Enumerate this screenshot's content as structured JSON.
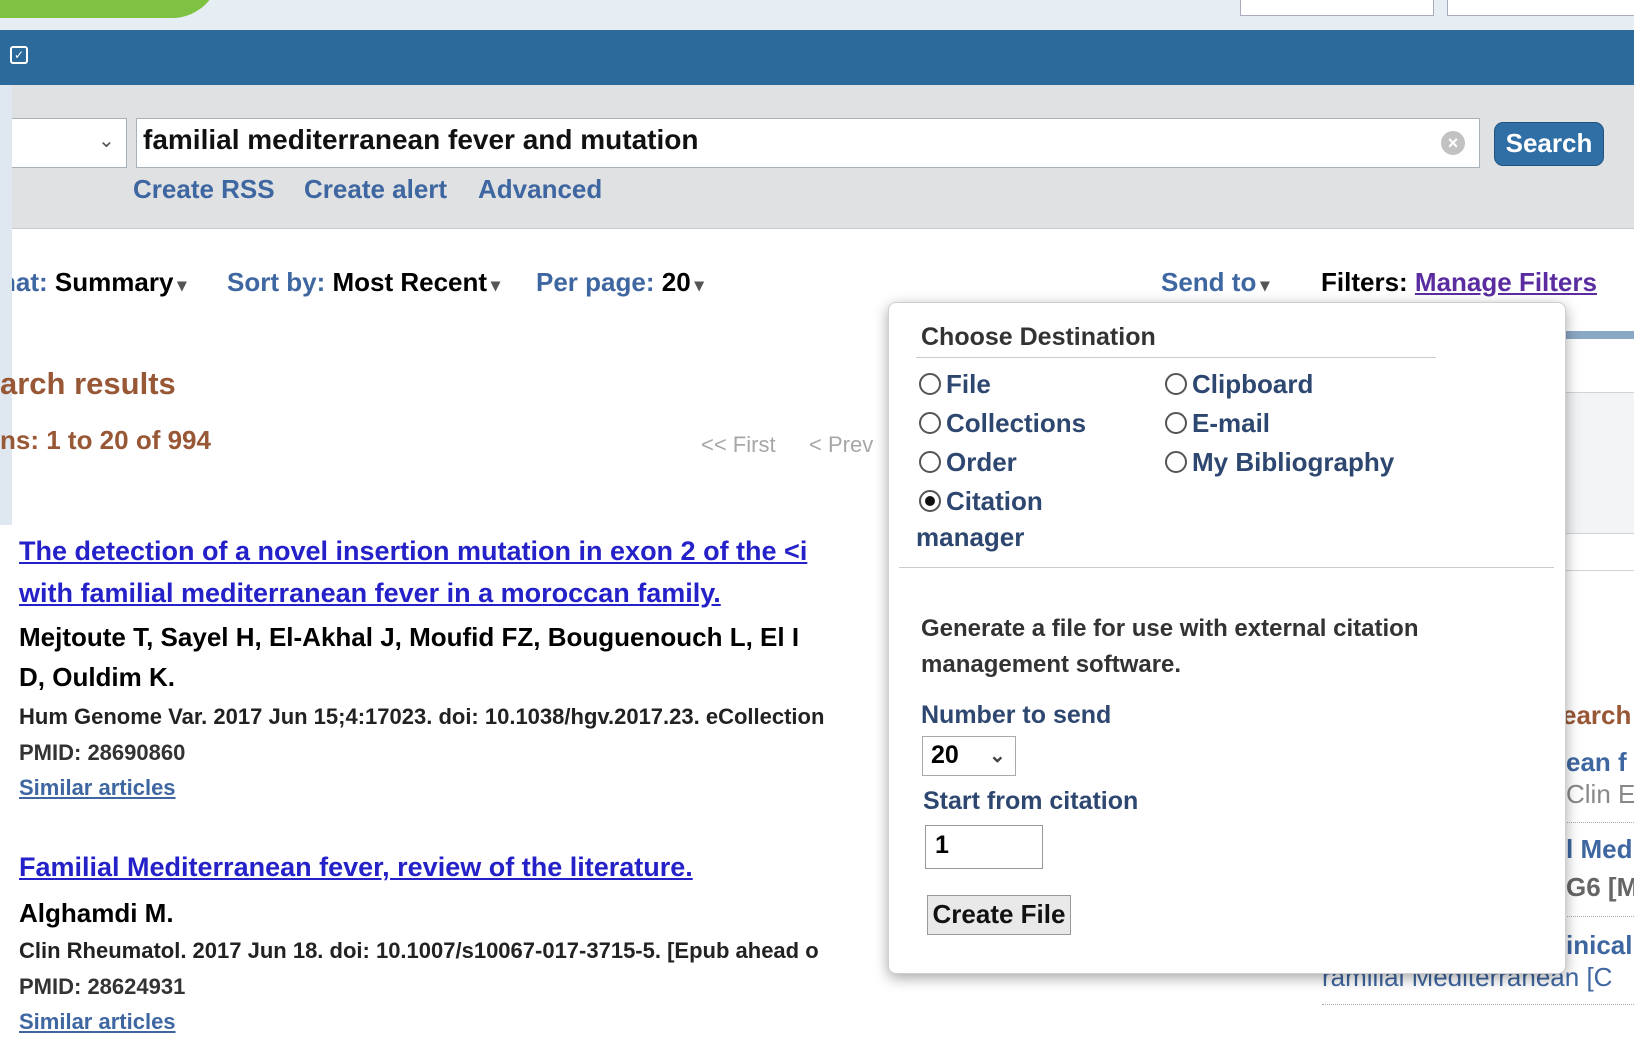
{
  "search": {
    "query": "familial mediterranean fever and mutation",
    "button_label": "Search",
    "links": [
      "Create RSS",
      "Create alert",
      "Advanced"
    ]
  },
  "toolbar": {
    "format_label": "nat:",
    "format_value": "Summary",
    "sort_label": "Sort by:",
    "sort_value": "Most Recent",
    "per_page_label": "Per page:",
    "per_page_value": "20",
    "send_to": "Send to",
    "filters_label": "Filters:",
    "manage_filters": "Manage Filters"
  },
  "results": {
    "title": "arch results",
    "count": "ns: 1 to 20 of 994",
    "pager_first": "<< First",
    "pager_prev": "< Prev"
  },
  "articles": [
    {
      "title_line1": "The detection of a novel insertion mutation in exon 2 of the <i",
      "title_line2": "with familial mediterranean fever in a moroccan family.",
      "authors_line1": "Mejtoute T, Sayel H, El-Akhal J, Moufid FZ, Bouguenouch L, El I",
      "authors_line2": "D, Ouldim K.",
      "citation": "Hum Genome Var. 2017 Jun 15;4:17023. doi: 10.1038/hgv.2017.23. eCollection",
      "pmid": "PMID: 28690860",
      "similar": "Similar articles"
    },
    {
      "title_line1": "Familial Mediterranean fever, review of the literature.",
      "authors_line1": "Alghamdi M.",
      "citation": "Clin Rheumatol. 2017 Jun 18. doi: 10.1007/s10067-017-3715-5. [Epub ahead o",
      "pmid": "PMID: 28624931",
      "similar": "Similar articles"
    }
  ],
  "right_column": {
    "heading": "earch",
    "item1_line1": "ean f",
    "item1_line2": "Clin E",
    "item2_line1": "l Med",
    "item2_line2": "G6 [M",
    "item3_line1": "inical",
    "item3_line2": "ramilial Mediterranean [C"
  },
  "popup": {
    "title": "Choose Destination",
    "options_left": [
      "File",
      "Collections",
      "Order",
      "Citation"
    ],
    "option_left_extra": "manager",
    "options_right": [
      "Clipboard",
      "E-mail",
      "My Bibliography"
    ],
    "selected": "Citation manager",
    "description": "Generate a file for use with external citation management software.",
    "number_label": "Number to send",
    "number_value": "20",
    "start_label": "Start from citation",
    "start_value": "1",
    "create_button": "Create File"
  },
  "colors": {
    "header_blue": "#2d6a9c",
    "link_blue": "#3e66a0",
    "article_link": "#2521c8",
    "results_brown": "#985735",
    "manage_filters_purple": "#5a2ca0"
  }
}
